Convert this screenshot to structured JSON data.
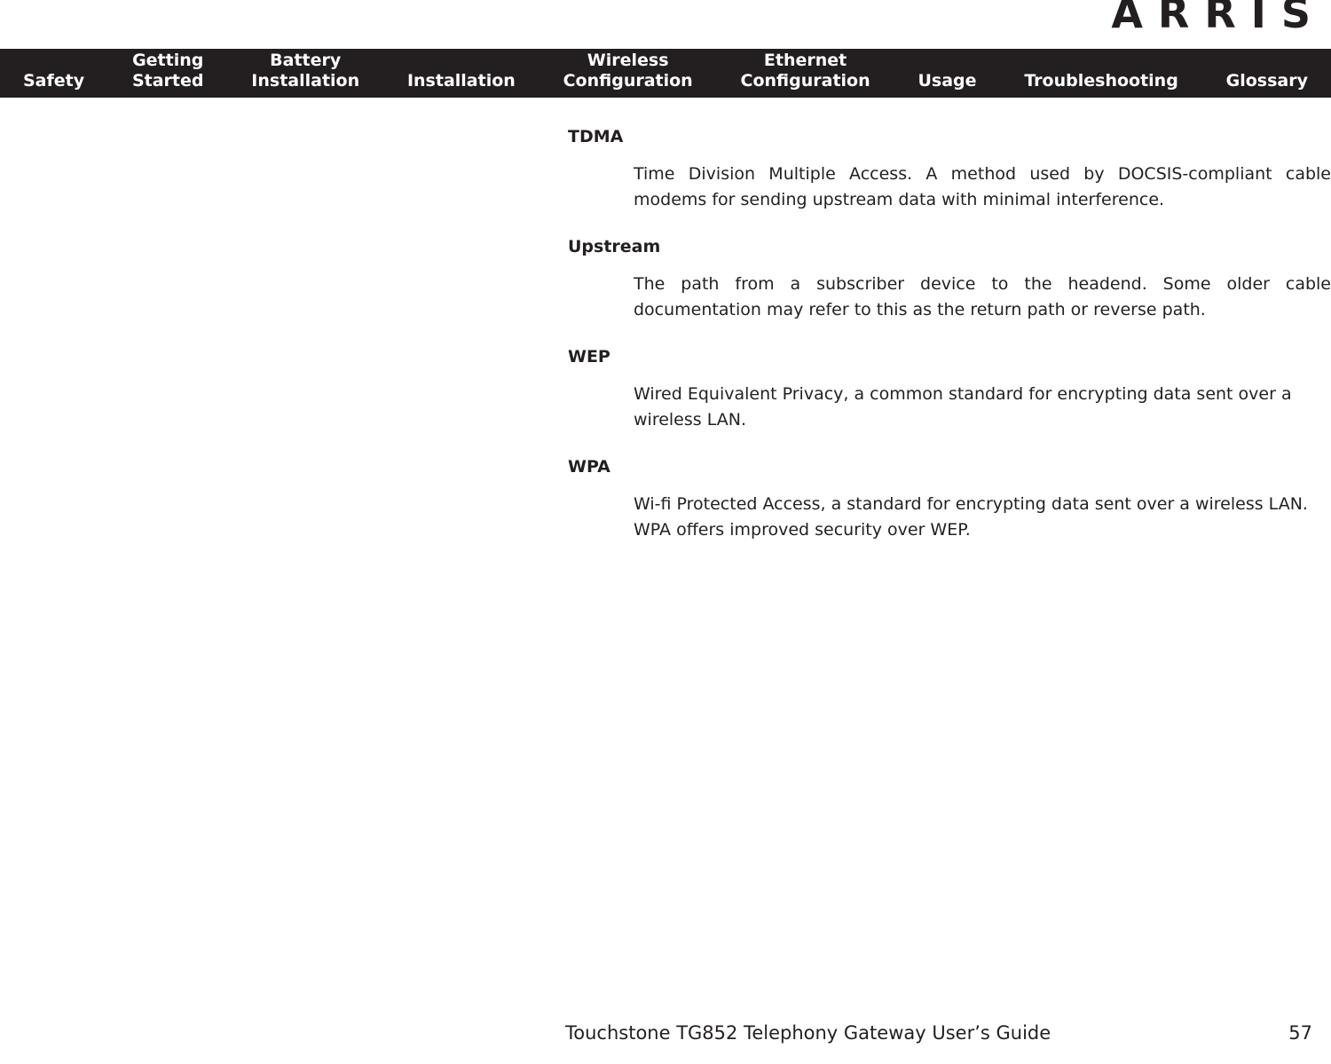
{
  "brand": {
    "logo_text": "ARRIS"
  },
  "nav": {
    "items": [
      {
        "lines": [
          "Safety"
        ]
      },
      {
        "lines": [
          "Getting",
          "Started"
        ]
      },
      {
        "lines": [
          "Battery",
          "Installation"
        ]
      },
      {
        "lines": [
          "Installation"
        ]
      },
      {
        "lines": [
          "Wireless",
          "Configuration"
        ]
      },
      {
        "lines": [
          "Ethernet",
          "Configuration"
        ]
      },
      {
        "lines": [
          "Usage"
        ]
      },
      {
        "lines": [
          "Troubleshooting"
        ]
      },
      {
        "lines": [
          "Glossary"
        ]
      }
    ]
  },
  "glossary": {
    "entries": [
      {
        "term": "TDMA",
        "definition": "Time Division Multiple Access. A method used by DOCSIS-compliant cable modems for sending upstream data with minimal interference."
      },
      {
        "term": "Upstream",
        "definition": "The path from a subscriber device to the headend. Some older cable documentation may refer to this as the return path or reverse path."
      },
      {
        "term": "WEP",
        "definition": "Wired Equivalent Privacy, a common standard for encrypting data sent over a wireless LAN."
      },
      {
        "term": "WPA",
        "definition": "Wi-fi Protected Access, a standard for encrypting data sent over a wireless LAN. WPA offers improved security over WEP."
      }
    ]
  },
  "footer": {
    "title": "Touchstone TG852 Telephony Gateway User’s Guide",
    "page_number": "57"
  }
}
